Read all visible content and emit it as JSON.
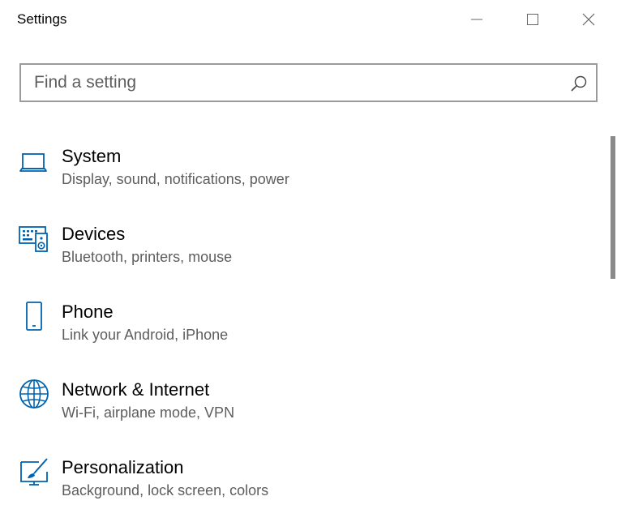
{
  "window": {
    "title": "Settings",
    "controls": {
      "minimize": "minimize-icon",
      "maximize": "maximize-icon",
      "close": "close-icon"
    }
  },
  "search": {
    "placeholder": "Find a setting",
    "value": "",
    "icon": "search-icon"
  },
  "categories": [
    {
      "label": "System",
      "description": "Display, sound, notifications, power",
      "icon": "laptop-icon"
    },
    {
      "label": "Devices",
      "description": "Bluetooth, printers, mouse",
      "icon": "devices-icon"
    },
    {
      "label": "Phone",
      "description": "Link your Android, iPhone",
      "icon": "phone-icon"
    },
    {
      "label": "Network & Internet",
      "description": "Wi-Fi, airplane mode, VPN",
      "icon": "globe-icon"
    },
    {
      "label": "Personalization",
      "description": "Background, lock screen, colors",
      "icon": "paintbrush-icon"
    }
  ],
  "colors": {
    "accent": "#0063b1",
    "secondary_text": "#5d5d5d",
    "border": "#9a9a9a"
  }
}
